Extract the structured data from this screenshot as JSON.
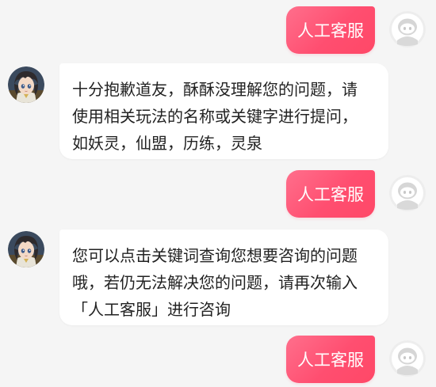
{
  "messages": [
    {
      "role": "user",
      "text": "人工客服"
    },
    {
      "role": "bot",
      "lines": [
        "十分抱歉道友，酥酥没理解您的问题，请",
        "使用相关玩法的名称或关键字进行提问，",
        "如妖灵，仙盟，历练，灵泉"
      ]
    },
    {
      "role": "user",
      "text": "人工客服"
    },
    {
      "role": "bot",
      "lines": [
        "您可以点击关键词查询您想要咨询的问题",
        "哦，若仍无法解决您的问题，请再次输入",
        "「人工客服」进行咨询"
      ]
    },
    {
      "role": "user",
      "text": "人工客服"
    }
  ],
  "icons": {
    "user_avatar": "default-user-avatar-icon",
    "bot_avatar": "anime-character-avatar"
  },
  "colors": {
    "background": "#f5f5f5",
    "user_bubble": "#ff4e70",
    "bot_bubble": "#ffffff",
    "bot_text": "#222222"
  }
}
